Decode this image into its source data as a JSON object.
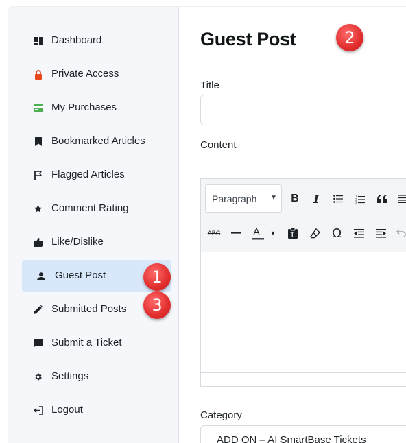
{
  "sidebar": {
    "items": [
      {
        "label": "Dashboard",
        "icon": "dashboard-icon"
      },
      {
        "label": "Private Access",
        "icon": "lock-icon"
      },
      {
        "label": "My Purchases",
        "icon": "credit-card-icon"
      },
      {
        "label": "Bookmarked Articles",
        "icon": "bookmark-icon"
      },
      {
        "label": "Flagged Articles",
        "icon": "flag-icon"
      },
      {
        "label": "Comment Rating",
        "icon": "star-icon"
      },
      {
        "label": "Like/Dislike",
        "icon": "thumbs-up-icon"
      },
      {
        "label": "Guest Post",
        "icon": "user-icon"
      },
      {
        "label": "Submitted Posts",
        "icon": "pencil-icon"
      },
      {
        "label": "Submit a Ticket",
        "icon": "chat-bubble-icon"
      },
      {
        "label": "Settings",
        "icon": "gear-icon"
      },
      {
        "label": "Logout",
        "icon": "logout-icon"
      }
    ],
    "active_index": 7
  },
  "annotations": {
    "badge1": "1",
    "badge2": "2",
    "badge3": "3"
  },
  "main": {
    "title": "Guest Post",
    "title_field": {
      "label": "Title",
      "value": ""
    },
    "content_field": {
      "label": "Content",
      "format_select": "Paragraph",
      "toolbar_row1": [
        "bold-icon",
        "italic-icon",
        "bulleted-list-icon",
        "numbered-list-icon",
        "blockquote-icon",
        "align-icon"
      ],
      "toolbar_row2": [
        "strikethrough-icon",
        "horizontal-line-icon",
        "text-color-icon",
        "paste-as-text-icon",
        "clear-formatting-icon",
        "special-character-icon",
        "outdent-icon",
        "indent-icon",
        "undo-icon"
      ]
    },
    "category_field": {
      "label": "Category",
      "value": "ADD ON – AI SmartBase Tickets"
    }
  },
  "colors": {
    "sidebar_bg": "#f6f7fb",
    "active_bg": "#d9e7fb",
    "lock_icon": "#e8481c",
    "card_icon": "#4caf50",
    "badge_red": "#e12d2d"
  }
}
